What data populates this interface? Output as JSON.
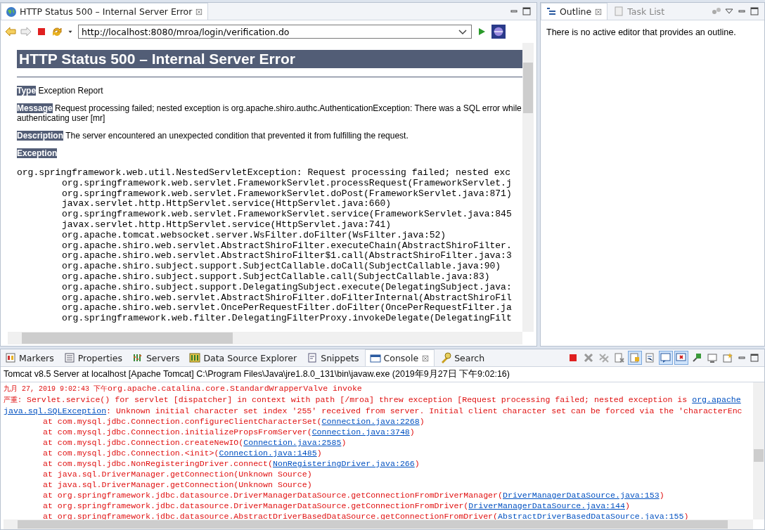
{
  "editor": {
    "tab": {
      "title": "HTTP Status 500 – Internal Server Error"
    },
    "url": "http://localhost:8080/mroa/login/verification.do",
    "page": {
      "heading": "HTTP Status 500 – Internal Server Error",
      "fields": [
        {
          "label": "Type",
          "text": "Exception Report"
        },
        {
          "label": "Message",
          "text": "Request processing failed; nested exception is org.apache.shiro.authc.AuthenticationException: There was a SQL error while authenticating user [mr]"
        },
        {
          "label": "Description",
          "text": "The server encountered an unexpected condition that prevented it from fulfilling the request."
        }
      ],
      "exception_label": "Exception",
      "trace": {
        "head": "org.springframework.web.util.NestedServletException: Request processing failed; nested exc",
        "frames": [
          "org.springframework.web.servlet.FrameworkServlet.processRequest(FrameworkServlet.j",
          "org.springframework.web.servlet.FrameworkServlet.doPost(FrameworkServlet.java:871)",
          "javax.servlet.http.HttpServlet.service(HttpServlet.java:660)",
          "org.springframework.web.servlet.FrameworkServlet.service(FrameworkServlet.java:845",
          "javax.servlet.http.HttpServlet.service(HttpServlet.java:741)",
          "org.apache.tomcat.websocket.server.WsFilter.doFilter(WsFilter.java:52)",
          "org.apache.shiro.web.servlet.AbstractShiroFilter.executeChain(AbstractShiroFilter.",
          "org.apache.shiro.web.servlet.AbstractShiroFilter$1.call(AbstractShiroFilter.java:3",
          "org.apache.shiro.subject.support.SubjectCallable.doCall(SubjectCallable.java:90)",
          "org.apache.shiro.subject.support.SubjectCallable.call(SubjectCallable.java:83)",
          "org.apache.shiro.subject.support.DelegatingSubject.execute(DelegatingSubject.java:",
          "org.apache.shiro.web.servlet.AbstractShiroFilter.doFilterInternal(AbstractShiroFil",
          "org.apache.shiro.web.servlet.OncePerRequestFilter.doFilter(OncePerRequestFilter.ja",
          "org.springframework.web.filter.DelegatingFilterProxy.invokeDelegate(DelegatingFilt"
        ]
      }
    }
  },
  "outline": {
    "tabs": [
      {
        "label": "Outline",
        "selected": true
      },
      {
        "label": "Task List",
        "selected": false
      }
    ],
    "message": "There is no active editor that provides an outline."
  },
  "bottom": {
    "tabs": [
      {
        "label": "Markers",
        "selected": false
      },
      {
        "label": "Properties",
        "selected": false
      },
      {
        "label": "Servers",
        "selected": false
      },
      {
        "label": "Data Source Explorer",
        "selected": false
      },
      {
        "label": "Snippets",
        "selected": false
      },
      {
        "label": "Console",
        "selected": true
      },
      {
        "label": "Search",
        "selected": false
      }
    ],
    "toolbar": [
      {
        "pressed": false
      },
      {
        "pressed": false
      },
      {
        "pressed": false
      },
      {
        "pressed": false
      },
      {
        "pressed": true
      },
      {
        "pressed": false
      },
      {
        "pressed": true
      },
      {
        "pressed": true
      },
      {
        "pressed": false
      },
      {
        "pressed": false
      },
      {
        "pressed": false
      }
    ],
    "process": "Tomcat v8.5 Server at localhost [Apache Tomcat] C:\\Program Files\\Java\\jre1.8.0_131\\bin\\javaw.exe (2019年9月27日 下午9:02:16)",
    "console": [
      {
        "kind": "line",
        "segments": [
          {
            "kind": "cjk",
            "text": "九月 27, 2019 9:02:43 下午"
          },
          {
            "kind": "text",
            "text": "org.apache.catalina.core.StandardWrapperValve invoke"
          }
        ]
      },
      {
        "kind": "line",
        "segments": [
          {
            "kind": "cjk",
            "text": "严重:"
          },
          {
            "kind": "text",
            "text": " Servlet.service() for servlet [dispatcher] in context with path [/mroa] threw exception [Request processing failed; nested exception is "
          },
          {
            "kind": "link",
            "text": "org.apache"
          }
        ]
      },
      {
        "kind": "line",
        "segments": [
          {
            "kind": "link",
            "text": "java.sql.SQLException"
          },
          {
            "kind": "text",
            "text": ": Unknown initial character set index '255' received from server. Initial client character set can be forced via the 'characterEnc"
          }
        ]
      },
      {
        "kind": "frame",
        "segments": [
          {
            "kind": "text",
            "text": "at com.mysql.jdbc.Connection.configureClientCharacterSet("
          },
          {
            "kind": "link",
            "text": "Connection.java:2268"
          },
          {
            "kind": "text",
            "text": ")"
          }
        ]
      },
      {
        "kind": "frame",
        "segments": [
          {
            "kind": "text",
            "text": "at com.mysql.jdbc.Connection.initializePropsFromServer("
          },
          {
            "kind": "link",
            "text": "Connection.java:3748"
          },
          {
            "kind": "text",
            "text": ")"
          }
        ]
      },
      {
        "kind": "frame",
        "segments": [
          {
            "kind": "text",
            "text": "at com.mysql.jdbc.Connection.createNewIO("
          },
          {
            "kind": "link",
            "text": "Connection.java:2585"
          },
          {
            "kind": "text",
            "text": ")"
          }
        ]
      },
      {
        "kind": "frame",
        "segments": [
          {
            "kind": "text",
            "text": "at com.mysql.jdbc.Connection.<init>("
          },
          {
            "kind": "link",
            "text": "Connection.java:1485"
          },
          {
            "kind": "text",
            "text": ")"
          }
        ]
      },
      {
        "kind": "frame",
        "segments": [
          {
            "kind": "text",
            "text": "at com.mysql.jdbc.NonRegisteringDriver.connect("
          },
          {
            "kind": "link",
            "text": "NonRegisteringDriver.java:266"
          },
          {
            "kind": "text",
            "text": ")"
          }
        ]
      },
      {
        "kind": "frame",
        "segments": [
          {
            "kind": "text",
            "text": "at java.sql.DriverManager.getConnection(Unknown Source)"
          }
        ]
      },
      {
        "kind": "frame",
        "segments": [
          {
            "kind": "text",
            "text": "at java.sql.DriverManager.getConnection(Unknown Source)"
          }
        ]
      },
      {
        "kind": "frame",
        "segments": [
          {
            "kind": "text",
            "text": "at org.springframework.jdbc.datasource.DriverManagerDataSource.getConnectionFromDriverManager("
          },
          {
            "kind": "link",
            "text": "DriverManagerDataSource.java:153"
          },
          {
            "kind": "text",
            "text": ")"
          }
        ]
      },
      {
        "kind": "frame",
        "segments": [
          {
            "kind": "text",
            "text": "at org.springframework.jdbc.datasource.DriverManagerDataSource.getConnectionFromDriver("
          },
          {
            "kind": "link",
            "text": "DriverManagerDataSource.java:144"
          },
          {
            "kind": "text",
            "text": ")"
          }
        ]
      },
      {
        "kind": "frame",
        "segments": [
          {
            "kind": "text",
            "text": "at org.springframework.jdbc.datasource.AbstractDriverBasedDataSource.getConnectionFromDriver("
          },
          {
            "kind": "link",
            "text": "AbstractDriverBasedDataSource.java:155"
          },
          {
            "kind": "text",
            "text": ")"
          }
        ]
      }
    ]
  }
}
